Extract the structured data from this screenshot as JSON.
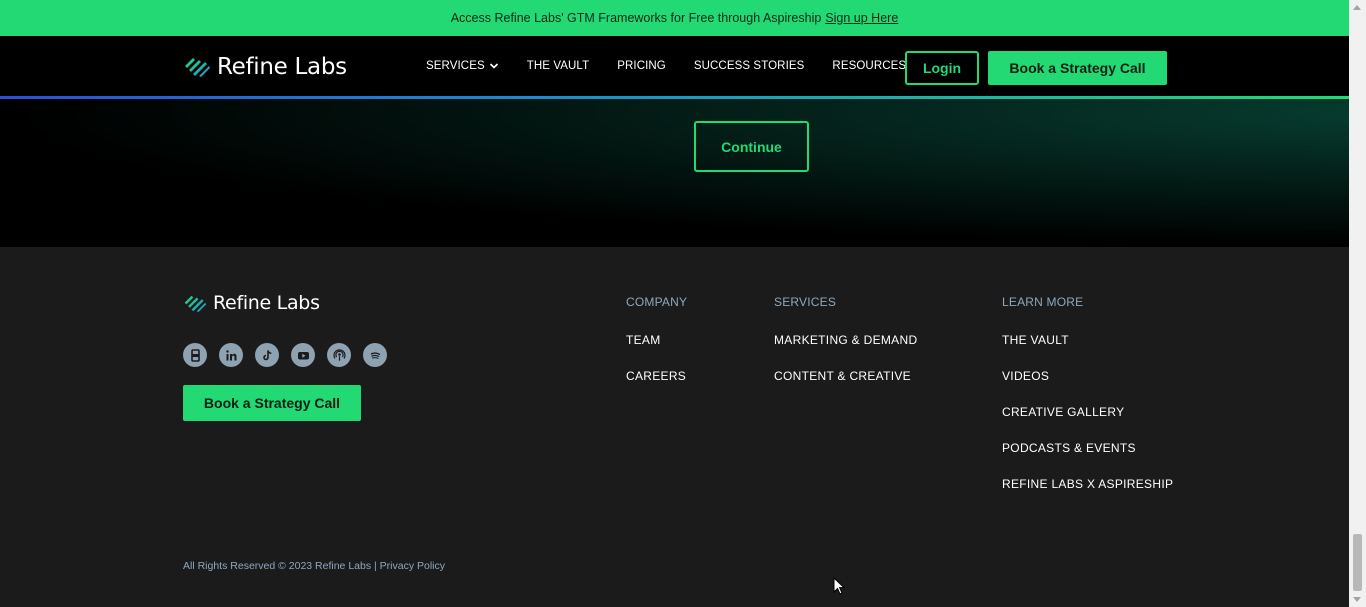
{
  "announcement": {
    "text": "Access Refine Labs' GTM Frameworks for Free through Aspireship",
    "link": "Sign up Here"
  },
  "brand": {
    "name": "Refine Labs"
  },
  "nav": {
    "items": [
      {
        "label": "SERVICES",
        "dropdown": true
      },
      {
        "label": "THE VAULT",
        "dropdown": false
      },
      {
        "label": "PRICING",
        "dropdown": false
      },
      {
        "label": "SUCCESS STORIES",
        "dropdown": false
      },
      {
        "label": "RESOURCES",
        "dropdown": true
      }
    ],
    "login_label": "Login",
    "cta_label": "Book a Strategy Call"
  },
  "hero": {
    "continue_label": "Continue"
  },
  "footer": {
    "socials": [
      "glassdoor-icon",
      "linkedin-icon",
      "tiktok-icon",
      "youtube-icon",
      "podcast-icon",
      "spotify-icon"
    ],
    "cta_label": "Book a Strategy Call",
    "columns": [
      {
        "heading": "COMPANY",
        "links": [
          "TEAM",
          "CAREERS"
        ]
      },
      {
        "heading": "SERVICES",
        "links": [
          "MARKETING & DEMAND",
          "CONTENT & CREATIVE"
        ]
      },
      {
        "heading": "LEARN MORE",
        "links": [
          "THE VAULT",
          "VIDEOS",
          "CREATIVE GALLERY",
          "PODCASTS & EVENTS",
          "REFINE LABS X ASPIRESHIP"
        ]
      }
    ],
    "copyright": "All Rights Reserved © 2023 Refine Labs |",
    "privacy_label": "Privacy Policy"
  },
  "colors": {
    "accent": "#22d974",
    "footer_bg": "#1b1b1b",
    "muted_text": "#8fa8bd"
  }
}
